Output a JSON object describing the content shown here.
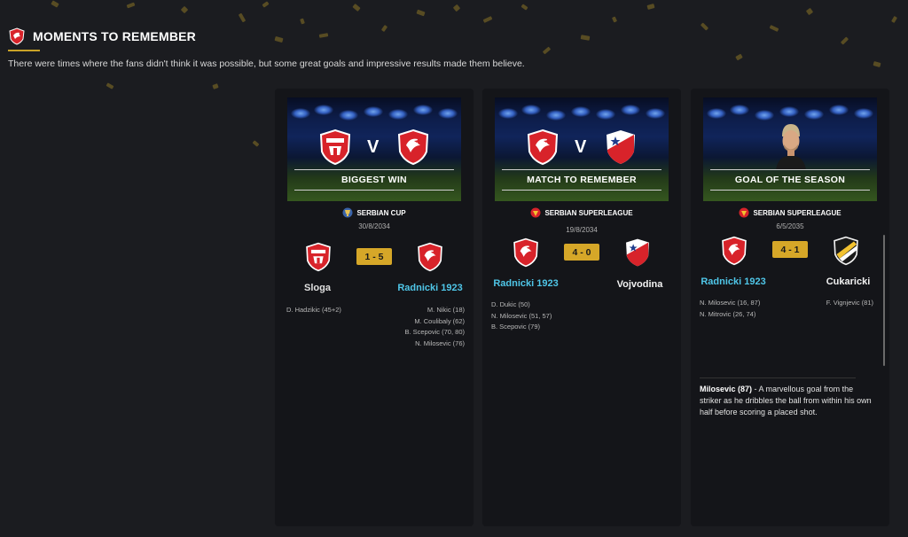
{
  "header": {
    "title": "MOMENTS TO REMEMBER",
    "description": "There were times where the fans didn't think it was possible, but some great goals and impressive results made them believe."
  },
  "cards": [
    {
      "label": "BIGGEST WIN",
      "vs": "V",
      "competition": "SERBIAN CUP",
      "date": "30/8/2034",
      "score": "1 - 5",
      "home_team": "Sloga",
      "away_team": "Radnicki 1923",
      "home_scorers": [
        "D. Hadzikic (45+2)"
      ],
      "away_scorers": [
        "M. Nikic (18)",
        "M. Coulibaly (62)",
        "B. Scepovic (70, 80)",
        "N. Milosevic (76)"
      ]
    },
    {
      "label": "MATCH TO REMEMBER",
      "vs": "V",
      "competition": "SERBIAN SUPERLEAGUE",
      "date": "19/8/2034",
      "score": "4 - 0",
      "home_team": "Radnicki 1923",
      "away_team": "Vojvodina",
      "home_scorers": [
        "D. Dukic (50)",
        "N. Milosevic (51, 57)",
        "B. Scepovic (79)"
      ],
      "away_scorers": []
    },
    {
      "label": "GOAL OF THE SEASON",
      "competition": "SERBIAN SUPERLEAGUE",
      "date": "6/5/2035",
      "score": "4 - 1",
      "home_team": "Radnicki 1923",
      "away_team": "Cukaricki",
      "home_scorers": [
        "N. Milosevic (16, 87)",
        "N. Mitrovic (26, 74)"
      ],
      "away_scorers": [
        "F. Vignjevic (81)"
      ],
      "goal_scorer": "Milosevic (87)",
      "goal_description": " - A marvellous goal from the striker as he dribbles the ball from within his own half before scoring a placed shot."
    }
  ],
  "icons": {
    "header": "club-crest-icon",
    "club_crest": "radnicki-eagle-crest-icon",
    "sloga_crest": "sloga-crest-icon",
    "vojvodina_crest": "vojvodina-crest-icon",
    "cukaricki_crest": "cukaricki-crest-icon",
    "cup_badge": "serbian-cup-icon",
    "league_badge": "superleague-icon",
    "player": "player-portrait"
  },
  "colors": {
    "accent": "#d6a728",
    "highlight_team": "#4fc6e8",
    "crest_red": "#d8232a"
  }
}
